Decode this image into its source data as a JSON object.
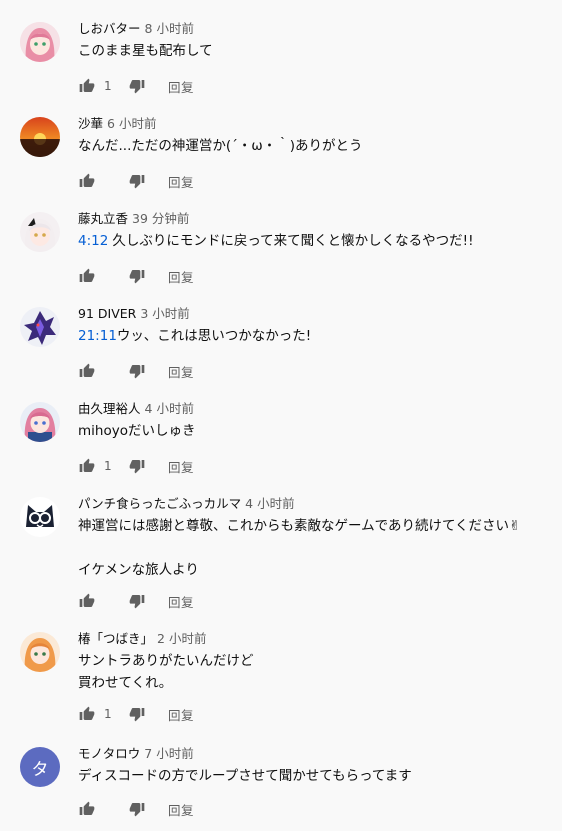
{
  "labels": {
    "reply": "回复"
  },
  "colors": {
    "background": "#f9f9f9",
    "link": "#065fd4",
    "icon": "#606060",
    "author": "#0f0f0f"
  },
  "comments": [
    {
      "author": "しおバター",
      "time": "8 小时前",
      "lines": [
        "このまま星も配布して"
      ],
      "likes": "1",
      "avatar": "anime-girl-pink-hair"
    },
    {
      "author": "沙華",
      "time": "6 小时前",
      "lines": [
        "なんだ...ただの神運営か(´・ω・｀)ありがとう"
      ],
      "likes": "",
      "avatar": "sunset"
    },
    {
      "author": "藤丸立香",
      "time": "39 分钟前",
      "timestamp_link": "4:12",
      "lines": [
        "久しぶりにモンドに戻って来て聞くと懐かしくなるやつだ!!"
      ],
      "likes": "",
      "avatar": "anime-girl-white-hair"
    },
    {
      "author": "91 DIVER",
      "time": "3 小时前",
      "timestamp_link": "21:11",
      "lines": [
        "ウッ、これは思いつかなかった!"
      ],
      "likes": "",
      "avatar": "purple-dragon"
    },
    {
      "author": "由久理裕人",
      "time": "4 小时前",
      "lines": [
        "mihoyoだいしゅき"
      ],
      "likes": "1",
      "avatar": "anime-girl-pink-hair-blue"
    },
    {
      "author": "パンチ食らったごふっカルマ",
      "time": "4 小时前",
      "lines": [
        "神運営には感謝と尊敬、これからも素敵なゲームであり続けてください✌",
        "",
        "イケメンな旅人より"
      ],
      "likes": "",
      "avatar": "cat-with-glasses"
    },
    {
      "author": "椿「つばき」",
      "time": "2 小时前",
      "lines": [
        "サントラありがたいんだけど",
        "買わせてくれ。"
      ],
      "likes": "1",
      "avatar": "anime-girl-orange-hair"
    },
    {
      "author": "モノタロウ",
      "time": "7 小时前",
      "lines": [
        "ディスコードの方でループさせて聞かせてもらってます"
      ],
      "likes": "",
      "avatar": "letter-avatar",
      "avatar_letter": "タ",
      "avatar_color": "#5c6bc0"
    }
  ]
}
